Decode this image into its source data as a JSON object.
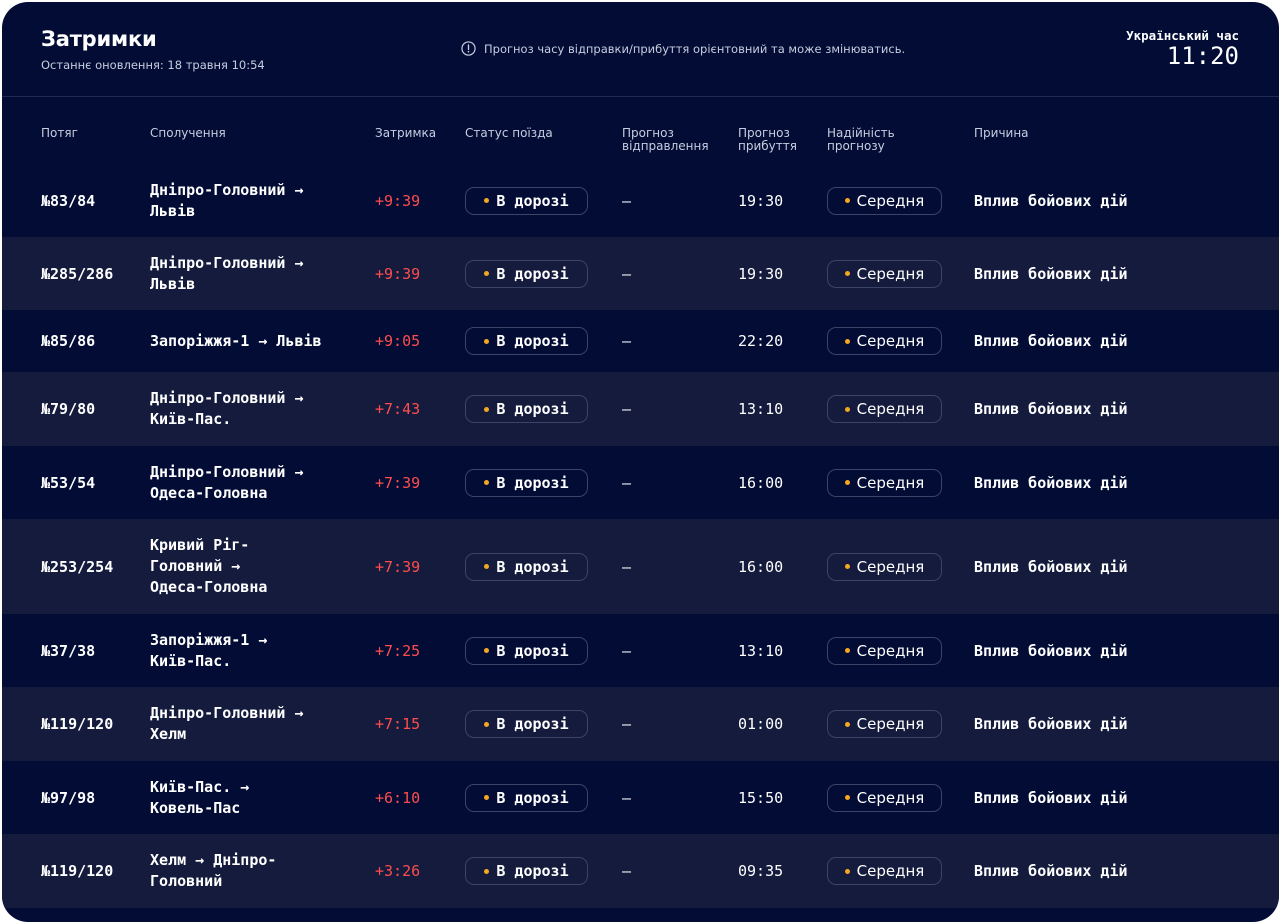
{
  "header": {
    "title": "Затримки",
    "updated": "Останнє оновлення: 18 травня 10:54",
    "notice": "Прогноз часу відправки/прибуття орієнтовний та може змінюватись.",
    "clock_label": "Український час",
    "clock_time": "11:20"
  },
  "columns": {
    "train": "Потяг",
    "route": "Сполучення",
    "delay": "Затримка",
    "status": "Статус поїзда",
    "departure": "Прогноз відправлення",
    "arrival": "Прогноз прибуття",
    "reliability": "Надійність прогнозу",
    "reason": "Причина"
  },
  "colors": {
    "background": "#020c35",
    "row_alt": "#141b3d",
    "delay": "#ff4d4d",
    "status_dot": "#f5a623"
  },
  "rows": [
    {
      "train": "№83/84",
      "route": "Дніпро-Головний → Львів",
      "delay": "+9:39",
      "status": "В дорозі",
      "departure": "—",
      "arrival": "19:30",
      "reliability": "Середня",
      "reason": "Вплив бойових дій"
    },
    {
      "train": "№285/286",
      "route": "Дніпро-Головний → Львів",
      "delay": "+9:39",
      "status": "В дорозі",
      "departure": "—",
      "arrival": "19:30",
      "reliability": "Середня",
      "reason": "Вплив бойових дій"
    },
    {
      "train": "№85/86",
      "route": "Запоріжжя-1 → Львів",
      "delay": "+9:05",
      "status": "В дорозі",
      "departure": "—",
      "arrival": "22:20",
      "reliability": "Середня",
      "reason": "Вплив бойових дій"
    },
    {
      "train": "№79/80",
      "route": "Дніпро-Головний → Київ-Пас.",
      "delay": "+7:43",
      "status": "В дорозі",
      "departure": "—",
      "arrival": "13:10",
      "reliability": "Середня",
      "reason": "Вплив бойових дій"
    },
    {
      "train": "№53/54",
      "route": "Дніпро-Головний → Одеса-Головна",
      "delay": "+7:39",
      "status": "В дорозі",
      "departure": "—",
      "arrival": "16:00",
      "reliability": "Середня",
      "reason": "Вплив бойових дій"
    },
    {
      "train": "№253/254",
      "route": "Кривий Ріг-Головний → Одеса-Головна",
      "delay": "+7:39",
      "status": "В дорозі",
      "departure": "—",
      "arrival": "16:00",
      "reliability": "Середня",
      "reason": "Вплив бойових дій"
    },
    {
      "train": "№37/38",
      "route": "Запоріжжя-1 → Київ-Пас.",
      "delay": "+7:25",
      "status": "В дорозі",
      "departure": "—",
      "arrival": "13:10",
      "reliability": "Середня",
      "reason": "Вплив бойових дій"
    },
    {
      "train": "№119/120",
      "route": "Дніпро-Головний → Хелм",
      "delay": "+7:15",
      "status": "В дорозі",
      "departure": "—",
      "arrival": "01:00",
      "reliability": "Середня",
      "reason": "Вплив бойових дій"
    },
    {
      "train": "№97/98",
      "route": "Київ-Пас. → Ковель-Пас",
      "delay": "+6:10",
      "status": "В дорозі",
      "departure": "—",
      "arrival": "15:50",
      "reliability": "Середня",
      "reason": "Вплив бойових дій"
    },
    {
      "train": "№119/120",
      "route": "Хелм → Дніпро-Головний",
      "delay": "+3:26",
      "status": "В дорозі",
      "departure": "—",
      "arrival": "09:35",
      "reliability": "Середня",
      "reason": "Вплив бойових дій"
    }
  ]
}
